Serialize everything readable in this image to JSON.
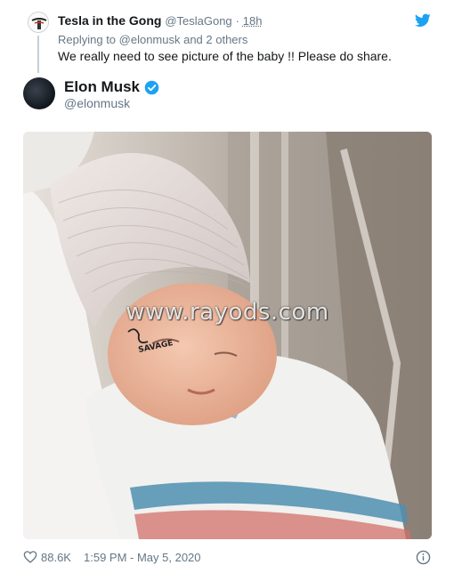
{
  "reply": {
    "name": "Tesla in the Gong",
    "handle": "@TeslaGong",
    "separator": "·",
    "time": "18h",
    "replying_to": "Replying to @elonmusk and 2 others",
    "text": "We really need to see picture of the baby !! Please do share."
  },
  "tweet": {
    "name": "Elon Musk",
    "handle": "@elonmusk",
    "watermark": "www.rayods.com",
    "tattoo_text": "SAVAGE",
    "likes": "88.6K",
    "timestamp": "1:59 PM - May 5, 2020"
  },
  "colors": {
    "twitter_blue": "#1da1f2",
    "secondary_text": "#657786",
    "primary_text": "#14171a"
  },
  "icons": [
    "twitter-bird-icon",
    "verified-badge-icon",
    "heart-icon",
    "info-icon"
  ]
}
